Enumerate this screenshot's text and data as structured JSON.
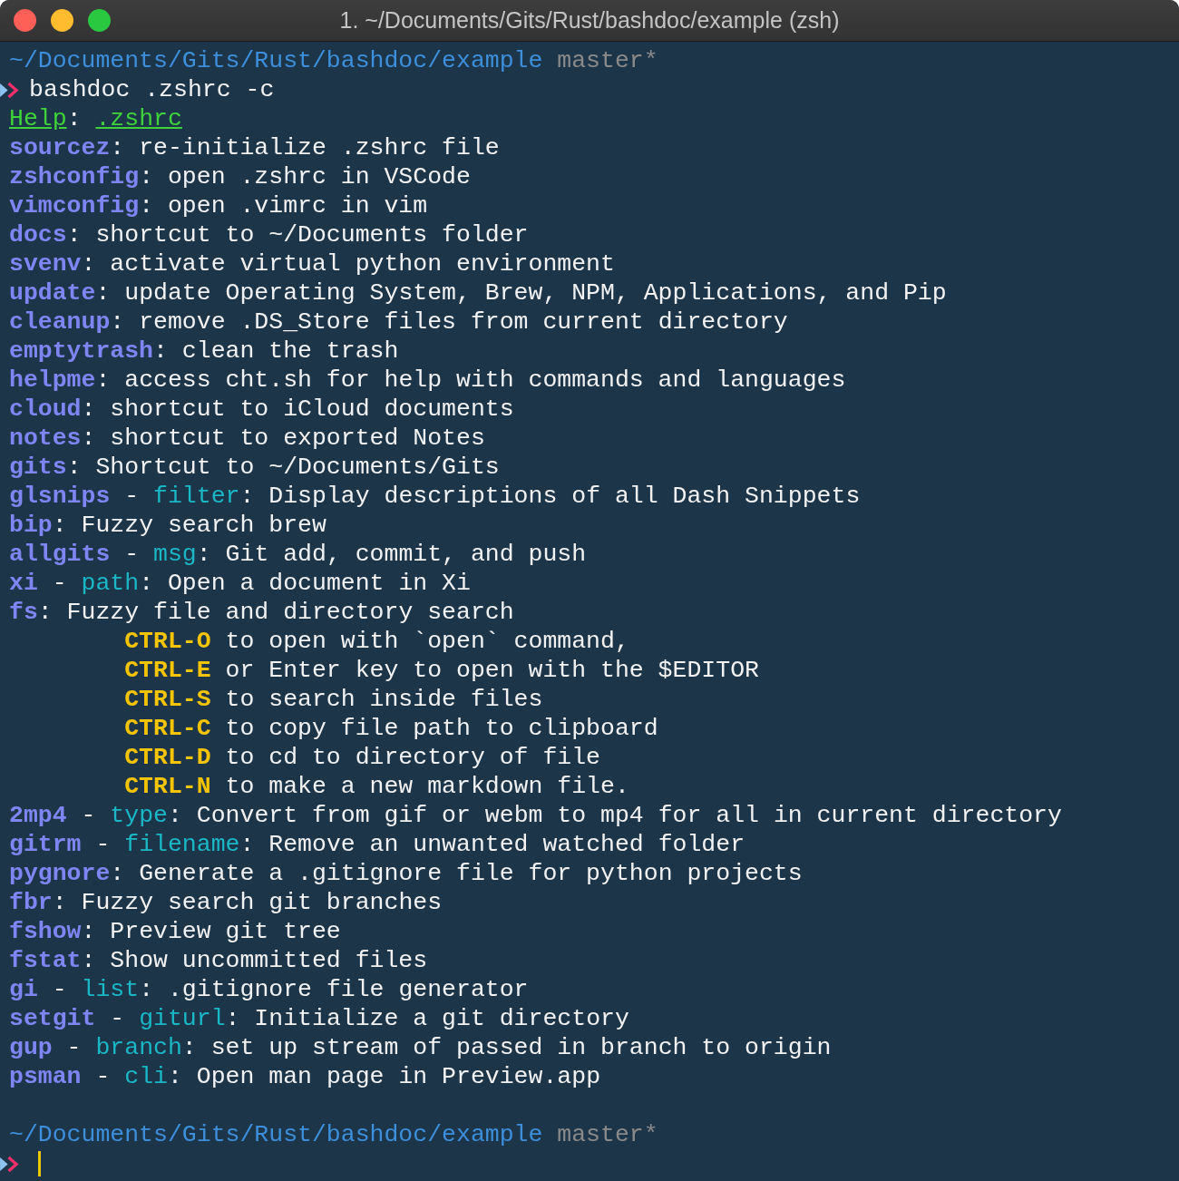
{
  "window": {
    "title": "1. ~/Documents/Gits/Rust/bashdoc/example (zsh)"
  },
  "lines": [
    {
      "kind": "path",
      "path": "~/Documents/Gits/Rust/bashdoc/example",
      "branch": "master*"
    },
    {
      "kind": "command",
      "text": "bashdoc .zshrc -c"
    },
    {
      "kind": "help",
      "label": "Help",
      "colon": ":",
      "file": ".zshrc"
    },
    {
      "kind": "entry",
      "name": "sourcez",
      "colon": ":",
      "description": "re-initialize .zshrc file"
    },
    {
      "kind": "entry",
      "name": "zshconfig",
      "colon": ":",
      "description": "open .zshrc in VSCode"
    },
    {
      "kind": "entry",
      "name": "vimconfig",
      "colon": ":",
      "description": "open .vimrc in vim"
    },
    {
      "kind": "entry",
      "name": "docs",
      "colon": ":",
      "description": "shortcut to ~/Documents folder"
    },
    {
      "kind": "entry",
      "name": "svenv",
      "colon": ":",
      "description": "activate virtual python environment"
    },
    {
      "kind": "entry",
      "name": "update",
      "colon": ":",
      "description": "update Operating System, Brew, NPM, Applications, and Pip"
    },
    {
      "kind": "entry",
      "name": "cleanup",
      "colon": ":",
      "description": "remove .DS_Store files from current directory"
    },
    {
      "kind": "entry",
      "name": "emptytrash",
      "colon": ":",
      "description": "clean the trash"
    },
    {
      "kind": "entry",
      "name": "helpme",
      "colon": ":",
      "description": "access cht.sh for help with commands and languages"
    },
    {
      "kind": "entry",
      "name": "cloud",
      "colon": ":",
      "description": "shortcut to iCloud documents"
    },
    {
      "kind": "entry",
      "name": "notes",
      "colon": ":",
      "description": "shortcut to exported Notes"
    },
    {
      "kind": "entry",
      "name": "gits",
      "colon": ":",
      "description": "Shortcut to ~/Documents/Gits"
    },
    {
      "kind": "entry",
      "name": "glsnips",
      "dash": "-",
      "param": "filter",
      "colon": ":",
      "description": "Display descriptions of all Dash Snippets"
    },
    {
      "kind": "entry",
      "name": "bip",
      "colon": ":",
      "description": "Fuzzy search brew"
    },
    {
      "kind": "entry",
      "name": "allgits",
      "dash": "-",
      "param": "msg",
      "colon": ":",
      "description": "Git add, commit, and push"
    },
    {
      "kind": "entry",
      "name": "xi",
      "dash": "-",
      "param": "path",
      "colon": ":",
      "description": "Open a document in Xi"
    },
    {
      "kind": "entry",
      "name": "fs",
      "colon": ":",
      "description": "Fuzzy file and directory search"
    },
    {
      "kind": "key",
      "key": "CTRL-O",
      "text": "to open with `open` command,"
    },
    {
      "kind": "key",
      "key": "CTRL-E",
      "text": "or Enter key to open with the $EDITOR"
    },
    {
      "kind": "key",
      "key": "CTRL-S",
      "text": "to search inside files"
    },
    {
      "kind": "key",
      "key": "CTRL-C",
      "text": "to copy file path to clipboard"
    },
    {
      "kind": "key",
      "key": "CTRL-D",
      "text": "to cd to directory of file"
    },
    {
      "kind": "key",
      "key": "CTRL-N",
      "text": "to make a new markdown file."
    },
    {
      "kind": "entry",
      "name": "2mp4",
      "dash": "-",
      "param": "type",
      "colon": ":",
      "description": "Convert from gif or webm to mp4 for all in current directory"
    },
    {
      "kind": "entry",
      "name": "gitrm",
      "dash": "-",
      "param": "filename",
      "colon": ":",
      "description": "Remove an unwanted watched folder"
    },
    {
      "kind": "entry",
      "name": "pygnore",
      "colon": ":",
      "description": "Generate a .gitignore file for python projects"
    },
    {
      "kind": "entry",
      "name": "fbr",
      "colon": ":",
      "description": "Fuzzy search git branches"
    },
    {
      "kind": "entry",
      "name": "fshow",
      "colon": ":",
      "description": "Preview git tree"
    },
    {
      "kind": "entry",
      "name": "fstat",
      "colon": ":",
      "description": "Show uncommitted files"
    },
    {
      "kind": "entry",
      "name": "gi",
      "dash": "-",
      "param": "list",
      "colon": ":",
      "description": ".gitignore file generator"
    },
    {
      "kind": "entry",
      "name": "setgit",
      "dash": "-",
      "param": "giturl",
      "colon": ":",
      "description": "Initialize a git directory"
    },
    {
      "kind": "entry",
      "name": "gup",
      "dash": "-",
      "param": "branch",
      "colon": ":",
      "description": "set up stream of passed in branch to origin"
    },
    {
      "kind": "entry",
      "name": "psman",
      "dash": "-",
      "param": "cli",
      "colon": ":",
      "description": "Open man page in Preview.app"
    },
    {
      "kind": "blank"
    },
    {
      "kind": "path",
      "path": "~/Documents/Gits/Rust/bashdoc/example",
      "branch": "master*"
    },
    {
      "kind": "input"
    }
  ]
}
